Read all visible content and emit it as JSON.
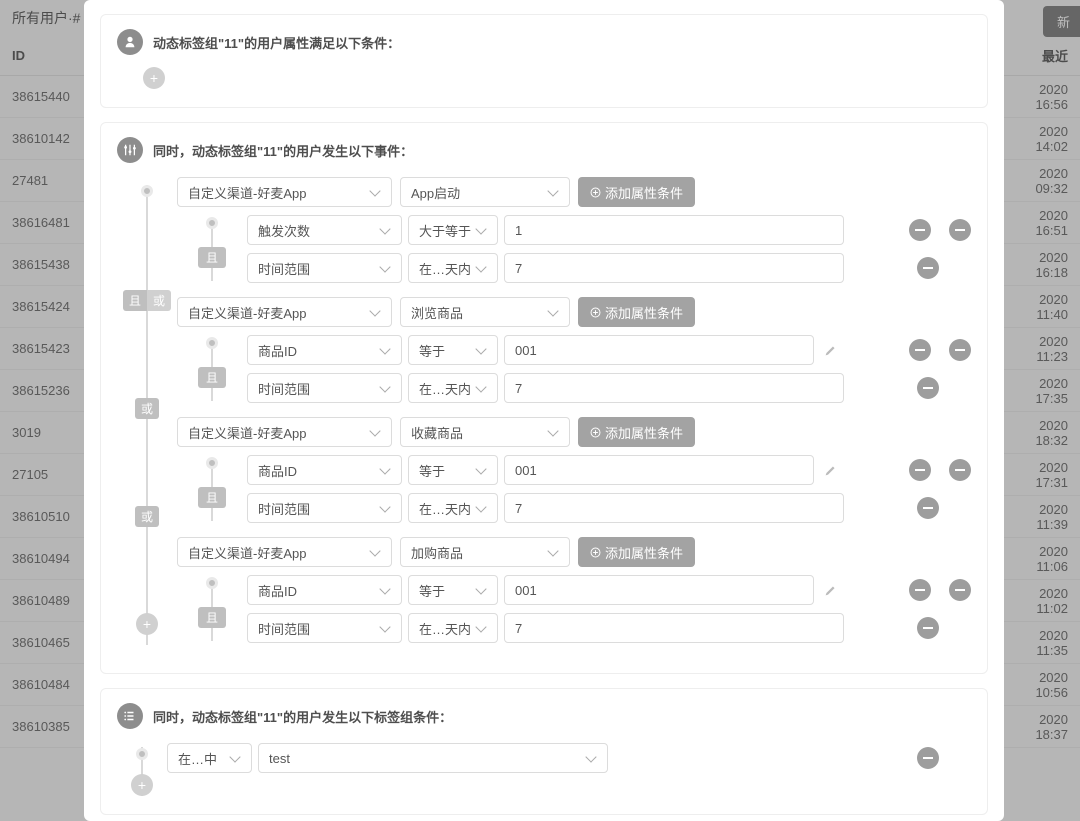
{
  "bg": {
    "header": "所有用户·#",
    "new_btn": "新",
    "col_id": "ID",
    "col_time": "最近",
    "rows": [
      {
        "id": "38615440",
        "t1": "2020",
        "t2": "16:56"
      },
      {
        "id": "38610142",
        "t1": "2020",
        "t2": "14:02"
      },
      {
        "id": "27481",
        "t1": "2020",
        "t2": "09:32"
      },
      {
        "id": "38616481",
        "t1": "2020",
        "t2": "16:51"
      },
      {
        "id": "38615438",
        "t1": "2020",
        "t2": "16:18"
      },
      {
        "id": "38615424",
        "t1": "2020",
        "t2": "11:40"
      },
      {
        "id": "38615423",
        "t1": "2020",
        "t2": "11:23"
      },
      {
        "id": "38615236",
        "t1": "2020",
        "t2": "17:35"
      },
      {
        "id": "3019",
        "t1": "2020",
        "t2": "18:32"
      },
      {
        "id": "27105",
        "t1": "2020",
        "t2": "17:31"
      },
      {
        "id": "38610510",
        "t1": "2020",
        "t2": "11:39"
      },
      {
        "id": "38610494",
        "t1": "2020",
        "t2": "11:06"
      },
      {
        "id": "38610489",
        "t1": "2020",
        "t2": "11:02"
      },
      {
        "id": "38610465",
        "t1": "2020",
        "t2": "11:35"
      },
      {
        "id": "38610484",
        "t1": "2020",
        "t2": "10:56"
      },
      {
        "id": "38610385",
        "t1": "2020",
        "t2": "18:37"
      }
    ]
  },
  "sections": {
    "s1_title": "动态标签组\"11\"的用户属性满足以下条件：",
    "s2_title": "同时，动态标签组\"11\"的用户发生以下事件：",
    "s3_title": "同时，动态标签组\"11\"的用户发生以下标签组条件："
  },
  "labels": {
    "add_attr": "添加属性条件",
    "and": "且",
    "or": "或"
  },
  "events": [
    {
      "conn": "start",
      "channel": "自定义渠道-好麦App",
      "event": "App启动",
      "subs": [
        {
          "attr": "触发次数",
          "op": "大于等于",
          "val": "1",
          "edit": false,
          "minus2": true
        },
        {
          "attr": "时间范围",
          "op": "在…天内",
          "val": "7",
          "edit": false,
          "minus2": false
        }
      ]
    },
    {
      "conn": "and_or",
      "channel": "自定义渠道-好麦App",
      "event": "浏览商品",
      "subs": [
        {
          "attr": "商品ID",
          "op": "等于",
          "val": "001",
          "edit": true,
          "minus2": true
        },
        {
          "attr": "时间范围",
          "op": "在…天内",
          "val": "7",
          "edit": false,
          "minus2": false
        }
      ]
    },
    {
      "conn": "or",
      "channel": "自定义渠道-好麦App",
      "event": "收藏商品",
      "subs": [
        {
          "attr": "商品ID",
          "op": "等于",
          "val": "001",
          "edit": true,
          "minus2": true
        },
        {
          "attr": "时间范围",
          "op": "在…天内",
          "val": "7",
          "edit": false,
          "minus2": false
        }
      ]
    },
    {
      "conn": "or",
      "channel": "自定义渠道-好麦App",
      "event": "加购商品",
      "subs": [
        {
          "attr": "商品ID",
          "op": "等于",
          "val": "001",
          "edit": true,
          "minus2": true
        },
        {
          "attr": "时间范围",
          "op": "在…天内",
          "val": "7",
          "edit": false,
          "minus2": false
        }
      ]
    }
  ],
  "tag_cond": {
    "mode": "在…中",
    "name": "test"
  }
}
